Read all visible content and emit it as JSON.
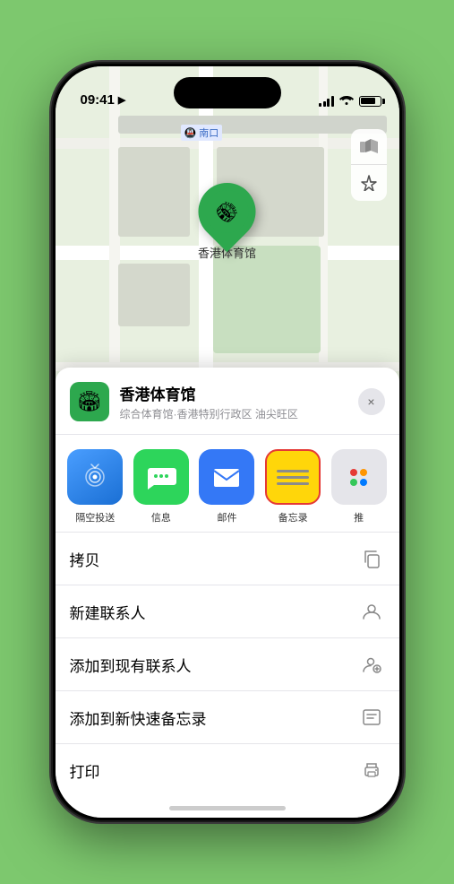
{
  "status_bar": {
    "time": "09:41",
    "location_arrow": "▶"
  },
  "map": {
    "label_text": "南口",
    "location_name": "香港体育馆"
  },
  "map_controls": {
    "map_icon": "🗺",
    "location_icon": "⬆"
  },
  "bottom_sheet": {
    "venue_name": "香港体育馆",
    "venue_subtitle": "综合体育馆·香港特别行政区 油尖旺区",
    "close_label": "×"
  },
  "share_apps": [
    {
      "id": "airdrop",
      "label": "隔空投送"
    },
    {
      "id": "messages",
      "label": "信息"
    },
    {
      "id": "mail",
      "label": "邮件"
    },
    {
      "id": "notes",
      "label": "备忘录"
    },
    {
      "id": "more",
      "label": "推"
    }
  ],
  "action_rows": [
    {
      "label": "拷贝",
      "icon": "copy"
    },
    {
      "label": "新建联系人",
      "icon": "person"
    },
    {
      "label": "添加到现有联系人",
      "icon": "person-add"
    },
    {
      "label": "添加到新快速备忘录",
      "icon": "note"
    },
    {
      "label": "打印",
      "icon": "print"
    }
  ]
}
